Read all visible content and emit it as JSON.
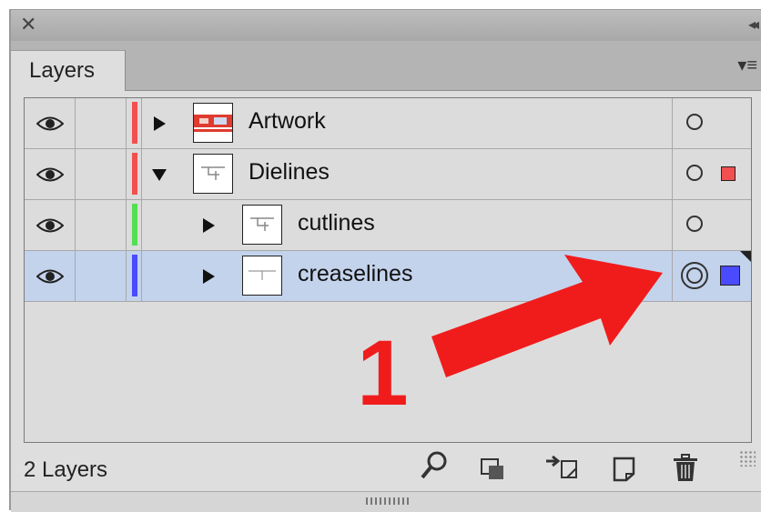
{
  "panel": {
    "close_glyph": "✕",
    "collapse_glyph": "◂◂",
    "tab_label": "Layers",
    "menu_glyph": "▾≡"
  },
  "layers": [
    {
      "name": "Artwork",
      "color": "#f25050",
      "expanded": false,
      "indent": 0,
      "selected": false,
      "has_selection": false
    },
    {
      "name": "Dielines",
      "color": "#f25050",
      "expanded": true,
      "indent": 0,
      "selected": false,
      "has_selection": true,
      "selection_color": "#f25050"
    },
    {
      "name": "cutlines",
      "color": "#52e052",
      "expanded": false,
      "indent": 1,
      "selected": false,
      "has_selection": false
    },
    {
      "name": "creaselines",
      "color": "#4a4aff",
      "expanded": false,
      "indent": 1,
      "selected": true,
      "has_selection": true,
      "selection_color": "#4a4aff"
    }
  ],
  "status": {
    "count_text": "2 Layers"
  },
  "toolbar_icons": [
    "search-icon",
    "clipping-mask-icon",
    "move-to-layer-icon",
    "new-layer-icon",
    "delete-icon"
  ],
  "annotation": {
    "number": "1",
    "color": "#f01c1c"
  }
}
